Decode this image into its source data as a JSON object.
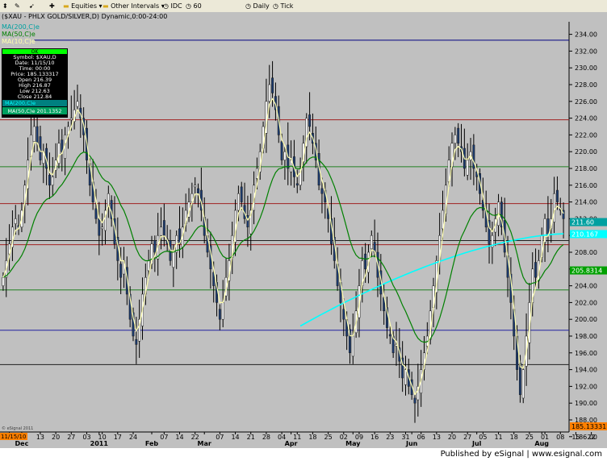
{
  "toolbar": {
    "items": [
      "Equities",
      "Other Intervals",
      "IDC",
      "60",
      "Daily",
      "Tick"
    ]
  },
  "titlebar": {
    "text": "($XAU - PHLX GOLD/SILVER,D) Dynamic,0:00-24:00"
  },
  "legend": {
    "ma200": "MA(200,C)e",
    "ma50": "MA(50,C)e",
    "ma10": "MA(10,C)e"
  },
  "cursor_box": {
    "title": "OK",
    "rows": [
      "Symbol: $XAU,D",
      "Date: 11/15/10",
      "Time: 00:00",
      "Price: 185.133317",
      "Open 216.39",
      "High 216.87",
      "Low 212.63",
      "Close 212.84",
      "MA(200,C)e",
      "MA(50,C)e 201.1352"
    ]
  },
  "footer": {
    "text": "Published by eSignal | www.esignal.com"
  },
  "chart_data": {
    "type": "candlestick",
    "symbol": "$XAU",
    "ylim": [
      185,
      235
    ],
    "yticks": [
      186,
      188,
      190,
      192,
      194,
      196,
      198,
      200,
      202,
      204,
      206,
      208,
      210,
      212,
      214,
      216,
      218,
      220,
      222,
      224,
      226,
      228,
      230,
      232,
      234
    ],
    "xlabels": [
      {
        "label": "29",
        "i": 2,
        "month": false
      },
      {
        "label": "Dec",
        "i": 6,
        "month": true
      },
      {
        "label": "13",
        "i": 12,
        "month": false
      },
      {
        "label": "20",
        "i": 17,
        "month": false
      },
      {
        "label": "27",
        "i": 22,
        "month": false
      },
      {
        "label": "03",
        "i": 27,
        "month": false
      },
      {
        "label": "2011",
        "i": 31,
        "month": true
      },
      {
        "label": "10",
        "i": 32,
        "month": false
      },
      {
        "label": "17",
        "i": 37,
        "month": false
      },
      {
        "label": "24",
        "i": 42,
        "month": false
      },
      {
        "label": "Feb",
        "i": 48,
        "month": true
      },
      {
        "label": "07",
        "i": 52,
        "month": false
      },
      {
        "label": "14",
        "i": 57,
        "month": false
      },
      {
        "label": "22",
        "i": 62,
        "month": false
      },
      {
        "label": "Mar",
        "i": 65,
        "month": true
      },
      {
        "label": "07",
        "i": 70,
        "month": false
      },
      {
        "label": "14",
        "i": 75,
        "month": false
      },
      {
        "label": "21",
        "i": 80,
        "month": false
      },
      {
        "label": "28",
        "i": 85,
        "month": false
      },
      {
        "label": "04",
        "i": 90,
        "month": false
      },
      {
        "label": "Apr",
        "i": 93,
        "month": true
      },
      {
        "label": "11",
        "i": 95,
        "month": false
      },
      {
        "label": "18",
        "i": 100,
        "month": false
      },
      {
        "label": "25",
        "i": 105,
        "month": false
      },
      {
        "label": "02",
        "i": 110,
        "month": false
      },
      {
        "label": "May",
        "i": 113,
        "month": true
      },
      {
        "label": "09",
        "i": 115,
        "month": false
      },
      {
        "label": "16",
        "i": 120,
        "month": false
      },
      {
        "label": "23",
        "i": 125,
        "month": false
      },
      {
        "label": "31",
        "i": 130,
        "month": false
      },
      {
        "label": "Jun",
        "i": 132,
        "month": true
      },
      {
        "label": "06",
        "i": 135,
        "month": false
      },
      {
        "label": "13",
        "i": 140,
        "month": false
      },
      {
        "label": "20",
        "i": 145,
        "month": false
      },
      {
        "label": "27",
        "i": 150,
        "month": false
      },
      {
        "label": "05",
        "i": 155,
        "month": false
      },
      {
        "label": "Jul",
        "i": 153,
        "month": true
      },
      {
        "label": "11",
        "i": 160,
        "month": false
      },
      {
        "label": "18",
        "i": 165,
        "month": false
      },
      {
        "label": "25",
        "i": 170,
        "month": false
      },
      {
        "label": "01",
        "i": 175,
        "month": false
      },
      {
        "label": "Aug",
        "i": 174,
        "month": true
      },
      {
        "label": "08",
        "i": 180,
        "month": false
      },
      {
        "label": "15",
        "i": 185,
        "month": false
      },
      {
        "label": "22",
        "i": 190,
        "month": false
      }
    ],
    "hlines": [
      {
        "value": 233.3,
        "color": "#000080"
      },
      {
        "value": 223.8,
        "color": "#a02020"
      },
      {
        "value": 218.2,
        "color": "#208020"
      },
      {
        "value": 213.8,
        "color": "#a02020"
      },
      {
        "value": 209.4,
        "color": "#202020"
      },
      {
        "value": 208.9,
        "color": "#a02020"
      },
      {
        "value": 203.5,
        "color": "#208020"
      },
      {
        "value": 198.7,
        "color": "#2020a0"
      },
      {
        "value": 194.6,
        "color": "#202020"
      }
    ],
    "closes": [
      205,
      207,
      209,
      211,
      212,
      211,
      213,
      216,
      219,
      222,
      223,
      221,
      219,
      220,
      218,
      216,
      217,
      219,
      221,
      220,
      222,
      223,
      224,
      225,
      226,
      224,
      222,
      219,
      216,
      214,
      212,
      210,
      211,
      213,
      215,
      212,
      209,
      207,
      205,
      207,
      203,
      200,
      198,
      197,
      200,
      203,
      205,
      207,
      209,
      208,
      210,
      211,
      210,
      209,
      207,
      208,
      210,
      209,
      211,
      213,
      214,
      215,
      216,
      215,
      213,
      210,
      208,
      206,
      204,
      202,
      200,
      202,
      205,
      207,
      210,
      213,
      215,
      214,
      212,
      211,
      213,
      216,
      218,
      220,
      223,
      226,
      228,
      227,
      225,
      222,
      219,
      220,
      218,
      219,
      217,
      216,
      218,
      221,
      224,
      223,
      221,
      219,
      216,
      215,
      214,
      212,
      209,
      207,
      204,
      202,
      200,
      198,
      196,
      198,
      201,
      204,
      207,
      206,
      208,
      210,
      208,
      205,
      203,
      201,
      199,
      198,
      196,
      197,
      195,
      193,
      194,
      192,
      191,
      190,
      192,
      194,
      196,
      198,
      201,
      204,
      207,
      210,
      213,
      216,
      219,
      221,
      222,
      221,
      220,
      218,
      219,
      220,
      218,
      217,
      215,
      213,
      211,
      209,
      210,
      212,
      214,
      211,
      208,
      205,
      202,
      198,
      194,
      191,
      194,
      198,
      202,
      206,
      205,
      207,
      210,
      212,
      210,
      212,
      215,
      214,
      213,
      212
    ],
    "series": [
      {
        "name": "MA(200,C)e",
        "color": "#00ffff",
        "start": 96,
        "start_value": 199.2,
        "end_value": 210.2
      },
      {
        "name": "MA(50,C)e",
        "color": "#008000",
        "period": 20,
        "end_value": 205.8314
      },
      {
        "name": "MA(10,C)e",
        "color": "#ffffb0",
        "period": 3,
        "end_value": 211.6
      }
    ],
    "right_labels": [
      {
        "text": "211.60",
        "value": 211.6,
        "bg": "#00a0a0",
        "fg": "#ffffff"
      },
      {
        "text": "210.167",
        "value": 210.167,
        "bg": "#00ffff",
        "fg": "#ffffff"
      },
      {
        "text": "205.8314",
        "value": 205.8314,
        "bg": "#00a000",
        "fg": "#ffffff"
      },
      {
        "text": "185.133317",
        "value": 185.1,
        "bg": "#ff8000",
        "fg": "#000000"
      }
    ],
    "left_date_label": "11/15/10",
    "copyright": "© eSignal 2011",
    "colors": {
      "background": "#c0c0c0",
      "bull": "#ffffff",
      "bear": "#1a3a6e",
      "wick": "#000000"
    }
  }
}
